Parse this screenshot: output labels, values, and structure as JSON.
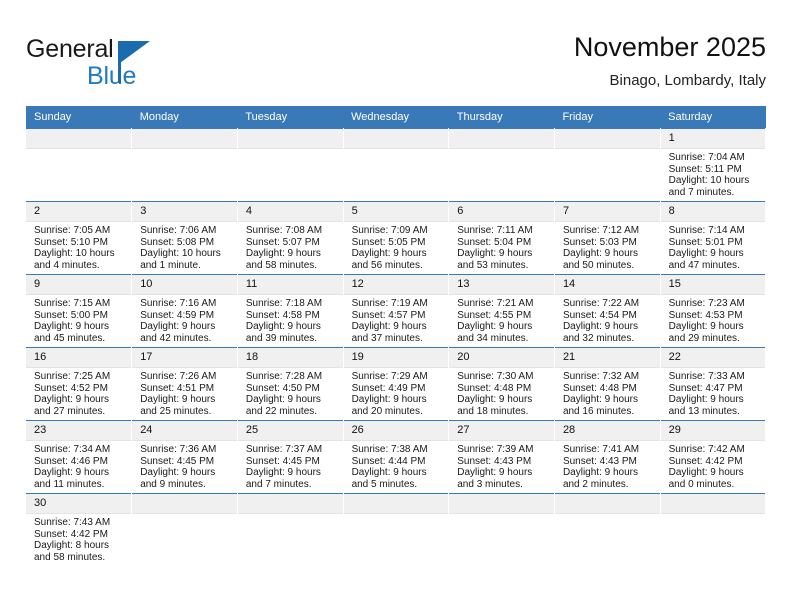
{
  "brand": {
    "line1": "General",
    "line2": "Blue",
    "triangle_color": "#1b6cae",
    "blue_text_color": "#1f7ac4"
  },
  "header": {
    "title": "November 2025",
    "subtitle": "Binago, Lombardy, Italy",
    "accent_color": "#3a79b8"
  },
  "weekdays": [
    "Sunday",
    "Monday",
    "Tuesday",
    "Wednesday",
    "Thursday",
    "Friday",
    "Saturday"
  ],
  "labels": {
    "sunrise_prefix": "Sunrise: ",
    "sunset_prefix": "Sunset: ",
    "daylight_prefix": "Daylight: "
  },
  "weeks": [
    [
      {
        "day": "",
        "blank": true
      },
      {
        "day": "",
        "blank": true
      },
      {
        "day": "",
        "blank": true
      },
      {
        "day": "",
        "blank": true
      },
      {
        "day": "",
        "blank": true
      },
      {
        "day": "",
        "blank": true
      },
      {
        "day": "1",
        "sunrise": "Sunrise: 7:04 AM",
        "sunset": "Sunset: 5:11 PM",
        "daylight1": "Daylight: 10 hours",
        "daylight2": "and 7 minutes."
      }
    ],
    [
      {
        "day": "2",
        "sunrise": "Sunrise: 7:05 AM",
        "sunset": "Sunset: 5:10 PM",
        "daylight1": "Daylight: 10 hours",
        "daylight2": "and 4 minutes."
      },
      {
        "day": "3",
        "sunrise": "Sunrise: 7:06 AM",
        "sunset": "Sunset: 5:08 PM",
        "daylight1": "Daylight: 10 hours",
        "daylight2": "and 1 minute."
      },
      {
        "day": "4",
        "sunrise": "Sunrise: 7:08 AM",
        "sunset": "Sunset: 5:07 PM",
        "daylight1": "Daylight: 9 hours",
        "daylight2": "and 58 minutes."
      },
      {
        "day": "5",
        "sunrise": "Sunrise: 7:09 AM",
        "sunset": "Sunset: 5:05 PM",
        "daylight1": "Daylight: 9 hours",
        "daylight2": "and 56 minutes."
      },
      {
        "day": "6",
        "sunrise": "Sunrise: 7:11 AM",
        "sunset": "Sunset: 5:04 PM",
        "daylight1": "Daylight: 9 hours",
        "daylight2": "and 53 minutes."
      },
      {
        "day": "7",
        "sunrise": "Sunrise: 7:12 AM",
        "sunset": "Sunset: 5:03 PM",
        "daylight1": "Daylight: 9 hours",
        "daylight2": "and 50 minutes."
      },
      {
        "day": "8",
        "sunrise": "Sunrise: 7:14 AM",
        "sunset": "Sunset: 5:01 PM",
        "daylight1": "Daylight: 9 hours",
        "daylight2": "and 47 minutes."
      }
    ],
    [
      {
        "day": "9",
        "sunrise": "Sunrise: 7:15 AM",
        "sunset": "Sunset: 5:00 PM",
        "daylight1": "Daylight: 9 hours",
        "daylight2": "and 45 minutes."
      },
      {
        "day": "10",
        "sunrise": "Sunrise: 7:16 AM",
        "sunset": "Sunset: 4:59 PM",
        "daylight1": "Daylight: 9 hours",
        "daylight2": "and 42 minutes."
      },
      {
        "day": "11",
        "sunrise": "Sunrise: 7:18 AM",
        "sunset": "Sunset: 4:58 PM",
        "daylight1": "Daylight: 9 hours",
        "daylight2": "and 39 minutes."
      },
      {
        "day": "12",
        "sunrise": "Sunrise: 7:19 AM",
        "sunset": "Sunset: 4:57 PM",
        "daylight1": "Daylight: 9 hours",
        "daylight2": "and 37 minutes."
      },
      {
        "day": "13",
        "sunrise": "Sunrise: 7:21 AM",
        "sunset": "Sunset: 4:55 PM",
        "daylight1": "Daylight: 9 hours",
        "daylight2": "and 34 minutes."
      },
      {
        "day": "14",
        "sunrise": "Sunrise: 7:22 AM",
        "sunset": "Sunset: 4:54 PM",
        "daylight1": "Daylight: 9 hours",
        "daylight2": "and 32 minutes."
      },
      {
        "day": "15",
        "sunrise": "Sunrise: 7:23 AM",
        "sunset": "Sunset: 4:53 PM",
        "daylight1": "Daylight: 9 hours",
        "daylight2": "and 29 minutes."
      }
    ],
    [
      {
        "day": "16",
        "sunrise": "Sunrise: 7:25 AM",
        "sunset": "Sunset: 4:52 PM",
        "daylight1": "Daylight: 9 hours",
        "daylight2": "and 27 minutes."
      },
      {
        "day": "17",
        "sunrise": "Sunrise: 7:26 AM",
        "sunset": "Sunset: 4:51 PM",
        "daylight1": "Daylight: 9 hours",
        "daylight2": "and 25 minutes."
      },
      {
        "day": "18",
        "sunrise": "Sunrise: 7:28 AM",
        "sunset": "Sunset: 4:50 PM",
        "daylight1": "Daylight: 9 hours",
        "daylight2": "and 22 minutes."
      },
      {
        "day": "19",
        "sunrise": "Sunrise: 7:29 AM",
        "sunset": "Sunset: 4:49 PM",
        "daylight1": "Daylight: 9 hours",
        "daylight2": "and 20 minutes."
      },
      {
        "day": "20",
        "sunrise": "Sunrise: 7:30 AM",
        "sunset": "Sunset: 4:48 PM",
        "daylight1": "Daylight: 9 hours",
        "daylight2": "and 18 minutes."
      },
      {
        "day": "21",
        "sunrise": "Sunrise: 7:32 AM",
        "sunset": "Sunset: 4:48 PM",
        "daylight1": "Daylight: 9 hours",
        "daylight2": "and 16 minutes."
      },
      {
        "day": "22",
        "sunrise": "Sunrise: 7:33 AM",
        "sunset": "Sunset: 4:47 PM",
        "daylight1": "Daylight: 9 hours",
        "daylight2": "and 13 minutes."
      }
    ],
    [
      {
        "day": "23",
        "sunrise": "Sunrise: 7:34 AM",
        "sunset": "Sunset: 4:46 PM",
        "daylight1": "Daylight: 9 hours",
        "daylight2": "and 11 minutes."
      },
      {
        "day": "24",
        "sunrise": "Sunrise: 7:36 AM",
        "sunset": "Sunset: 4:45 PM",
        "daylight1": "Daylight: 9 hours",
        "daylight2": "and 9 minutes."
      },
      {
        "day": "25",
        "sunrise": "Sunrise: 7:37 AM",
        "sunset": "Sunset: 4:45 PM",
        "daylight1": "Daylight: 9 hours",
        "daylight2": "and 7 minutes."
      },
      {
        "day": "26",
        "sunrise": "Sunrise: 7:38 AM",
        "sunset": "Sunset: 4:44 PM",
        "daylight1": "Daylight: 9 hours",
        "daylight2": "and 5 minutes."
      },
      {
        "day": "27",
        "sunrise": "Sunrise: 7:39 AM",
        "sunset": "Sunset: 4:43 PM",
        "daylight1": "Daylight: 9 hours",
        "daylight2": "and 3 minutes."
      },
      {
        "day": "28",
        "sunrise": "Sunrise: 7:41 AM",
        "sunset": "Sunset: 4:43 PM",
        "daylight1": "Daylight: 9 hours",
        "daylight2": "and 2 minutes."
      },
      {
        "day": "29",
        "sunrise": "Sunrise: 7:42 AM",
        "sunset": "Sunset: 4:42 PM",
        "daylight1": "Daylight: 9 hours",
        "daylight2": "and 0 minutes."
      }
    ],
    [
      {
        "day": "30",
        "sunrise": "Sunrise: 7:43 AM",
        "sunset": "Sunset: 4:42 PM",
        "daylight1": "Daylight: 8 hours",
        "daylight2": "and 58 minutes."
      },
      {
        "day": "",
        "blank": true
      },
      {
        "day": "",
        "blank": true
      },
      {
        "day": "",
        "blank": true
      },
      {
        "day": "",
        "blank": true
      },
      {
        "day": "",
        "blank": true
      },
      {
        "day": "",
        "blank": true
      }
    ]
  ]
}
